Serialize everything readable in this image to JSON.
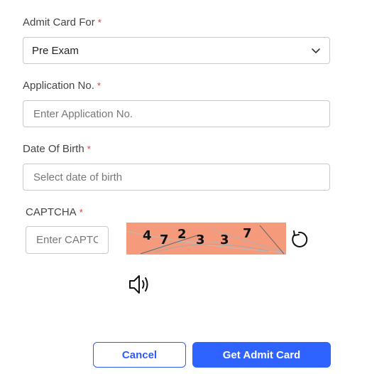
{
  "form": {
    "admit_card_for": {
      "label": "Admit Card For",
      "required": "*",
      "selected": "Pre Exam"
    },
    "application_no": {
      "label": "Application No.",
      "required": "*",
      "placeholder": "Enter Application No."
    },
    "dob": {
      "label": "Date Of Birth",
      "required": "*",
      "placeholder": "Select date of birth"
    },
    "captcha": {
      "label": "CAPTCHA",
      "required": "*",
      "placeholder": "Enter CAPTCHA",
      "code": [
        "4",
        "7",
        "2",
        "3",
        "3",
        "7"
      ]
    }
  },
  "buttons": {
    "cancel": "Cancel",
    "submit": "Get Admit Card"
  },
  "icons": {
    "dropdown": "chevron-down-icon",
    "refresh": "refresh-icon",
    "audio": "speaker-icon"
  },
  "colors": {
    "primary": "#2f63ff",
    "required": "#e0383e",
    "captcha_bg": "#f59a7a"
  }
}
